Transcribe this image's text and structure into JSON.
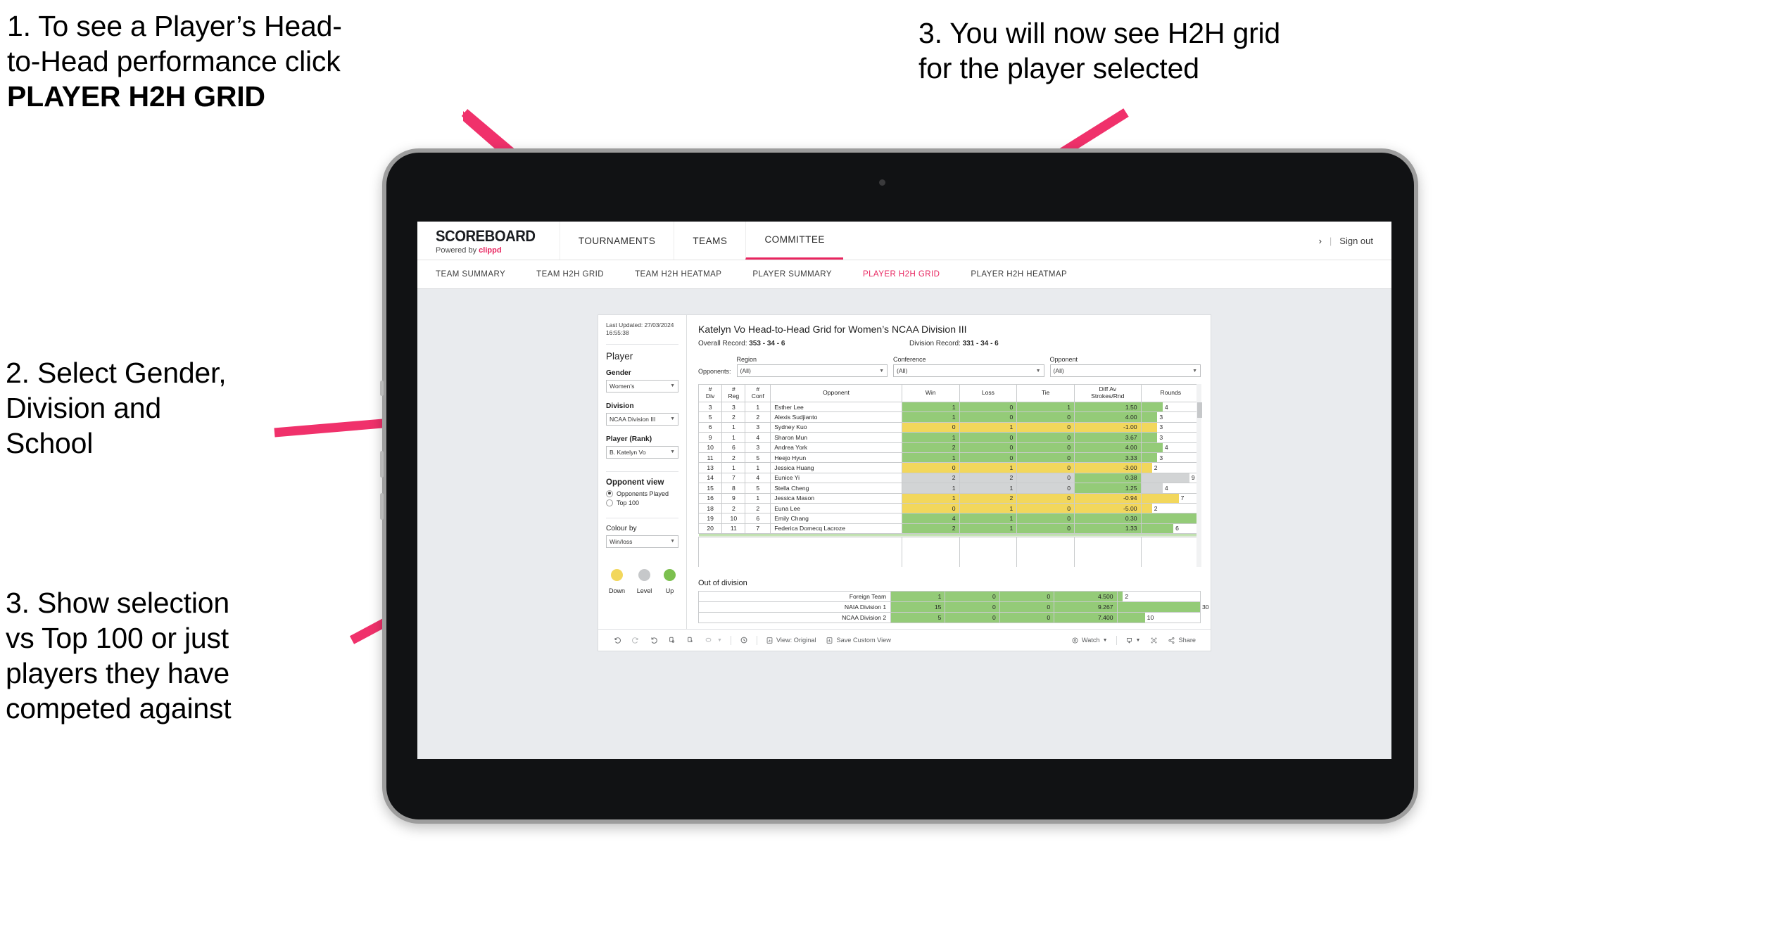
{
  "annotations": {
    "a1_line1": "1. To see a Player’s Head-",
    "a1_line2": "to-Head performance click",
    "a1_bold": "PLAYER H2H GRID",
    "a2": "2. Select Gender,\nDivision and\nSchool",
    "a3": "3. Show selection\nvs Top 100 or just\nplayers they have\ncompeted against",
    "a4": "3. You will now see H2H grid\nfor the player selected"
  },
  "colors": {
    "accent_pink": "#e8255f",
    "arrow_pink": "#f0316b",
    "up_green": "#94cb78",
    "down_yellow": "#f2d75c",
    "level_grey": "#d2d4d5"
  },
  "app": {
    "brand_title": "SCOREBOARD",
    "brand_sub_prefix": "Powered by ",
    "brand_sub_accent": "clippd",
    "topnav": [
      {
        "label": "TOURNAMENTS",
        "active": false
      },
      {
        "label": "TEAMS",
        "active": false
      },
      {
        "label": "COMMITTEE",
        "active": true
      }
    ],
    "signout": {
      "chevron": "›",
      "separator": "|",
      "label": "Sign out"
    },
    "subnav": [
      {
        "label": "TEAM SUMMARY",
        "active": false
      },
      {
        "label": "TEAM H2H GRID",
        "active": false
      },
      {
        "label": "TEAM H2H HEATMAP",
        "active": false
      },
      {
        "label": "PLAYER SUMMARY",
        "active": false
      },
      {
        "label": "PLAYER H2H GRID",
        "active": true
      },
      {
        "label": "PLAYER H2H HEATMAP",
        "active": false
      }
    ]
  },
  "sidebar": {
    "last_updated": "Last Updated: 27/03/2024 16:55:38",
    "player_heading": "Player",
    "filters": [
      {
        "label": "Gender",
        "value": "Women's"
      },
      {
        "label": "Division",
        "value": "NCAA Division III"
      },
      {
        "label": "Player (Rank)",
        "value": "B. Katelyn Vo"
      }
    ],
    "opponent_view": {
      "heading": "Opponent view",
      "options": [
        {
          "label": "Opponents Played",
          "selected": true
        },
        {
          "label": "Top 100",
          "selected": false
        }
      ]
    },
    "colour_by": {
      "label": "Colour by",
      "value": "Win/loss"
    },
    "legend": [
      {
        "label": "Down",
        "color": "#f2d75c"
      },
      {
        "label": "Level",
        "color": "#c6c8ca"
      },
      {
        "label": "Up",
        "color": "#7cc04f"
      }
    ]
  },
  "view": {
    "title": "Katelyn Vo Head-to-Head Grid for Women’s NCAA Division III",
    "overall_record_label": "Overall Record: ",
    "overall_record_value": "353 -  34 - 6",
    "division_record_label": "Division Record: ",
    "division_record_value": "331 -  34 - 6",
    "opponents_label": "Opponents:",
    "opponent_filters": [
      {
        "label": "Region",
        "value": "(All)"
      },
      {
        "label": "Conference",
        "value": "(All)"
      },
      {
        "label": "Opponent",
        "value": "(All)"
      }
    ]
  },
  "chart_data": {
    "type": "table",
    "title": "Katelyn Vo Head-to-Head Grid for Women’s NCAA Division III",
    "columns": [
      "# Div",
      "# Reg",
      "# Conf",
      "Opponent",
      "Win",
      "Loss",
      "Tie",
      "Diff Av Strokes/Rnd",
      "Rounds"
    ],
    "column_header_lines": [
      [
        "#",
        "Div"
      ],
      [
        "#",
        "Reg"
      ],
      [
        "#",
        "Conf"
      ],
      [
        "Opponent",
        ""
      ],
      [
        "Win",
        ""
      ],
      [
        "Loss",
        ""
      ],
      [
        "Tie",
        ""
      ],
      [
        "Diff Av",
        "Strokes/Rnd"
      ],
      [
        "Rounds",
        ""
      ]
    ],
    "rows": [
      {
        "div": "3",
        "reg": "3",
        "conf": "1",
        "opponent": "Esther Lee",
        "win": "1",
        "loss": "0",
        "tie": "1",
        "diff": "1.50",
        "rounds": "4",
        "state": "up"
      },
      {
        "div": "5",
        "reg": "2",
        "conf": "2",
        "opponent": "Alexis Sudjianto",
        "win": "1",
        "loss": "0",
        "tie": "0",
        "diff": "4.00",
        "rounds": "3",
        "state": "up"
      },
      {
        "div": "6",
        "reg": "1",
        "conf": "3",
        "opponent": "Sydney Kuo",
        "win": "0",
        "loss": "1",
        "tie": "0",
        "diff": "-1.00",
        "rounds": "3",
        "state": "down"
      },
      {
        "div": "9",
        "reg": "1",
        "conf": "4",
        "opponent": "Sharon Mun",
        "win": "1",
        "loss": "0",
        "tie": "0",
        "diff": "3.67",
        "rounds": "3",
        "state": "up"
      },
      {
        "div": "10",
        "reg": "6",
        "conf": "3",
        "opponent": "Andrea York",
        "win": "2",
        "loss": "0",
        "tie": "0",
        "diff": "4.00",
        "rounds": "4",
        "state": "up"
      },
      {
        "div": "11",
        "reg": "2",
        "conf": "5",
        "opponent": "Heejo Hyun",
        "win": "1",
        "loss": "0",
        "tie": "0",
        "diff": "3.33",
        "rounds": "3",
        "state": "up"
      },
      {
        "div": "13",
        "reg": "1",
        "conf": "1",
        "opponent": "Jessica Huang",
        "win": "0",
        "loss": "1",
        "tie": "0",
        "diff": "-3.00",
        "rounds": "2",
        "state": "down"
      },
      {
        "div": "14",
        "reg": "7",
        "conf": "4",
        "opponent": "Eunice Yi",
        "win": "2",
        "loss": "2",
        "tie": "0",
        "diff": "0.38",
        "rounds": "9",
        "state": "level"
      },
      {
        "div": "15",
        "reg": "8",
        "conf": "5",
        "opponent": "Stella Cheng",
        "win": "1",
        "loss": "1",
        "tie": "0",
        "diff": "1.25",
        "rounds": "4",
        "state": "level"
      },
      {
        "div": "16",
        "reg": "9",
        "conf": "1",
        "opponent": "Jessica Mason",
        "win": "1",
        "loss": "2",
        "tie": "0",
        "diff": "-0.94",
        "rounds": "7",
        "state": "down"
      },
      {
        "div": "18",
        "reg": "2",
        "conf": "2",
        "opponent": "Euna Lee",
        "win": "0",
        "loss": "1",
        "tie": "0",
        "diff": "-5.00",
        "rounds": "2",
        "state": "down"
      },
      {
        "div": "19",
        "reg": "10",
        "conf": "6",
        "opponent": "Emily Chang",
        "win": "4",
        "loss": "1",
        "tie": "0",
        "diff": "0.30",
        "rounds": "11",
        "state": "up"
      },
      {
        "div": "20",
        "reg": "11",
        "conf": "7",
        "opponent": "Federica Domecq Lacroze",
        "win": "2",
        "loss": "1",
        "tie": "0",
        "diff": "1.33",
        "rounds": "6",
        "state": "up"
      }
    ],
    "max_rounds": 11,
    "out_of_division": {
      "heading": "Out of division",
      "rows": [
        {
          "opponent": "Foreign Team",
          "win": "1",
          "loss": "0",
          "tie": "0",
          "diff": "4.500",
          "rounds": "2",
          "state": "up"
        },
        {
          "opponent": "NAIA Division 1",
          "win": "15",
          "loss": "0",
          "tie": "0",
          "diff": "9.267",
          "rounds": "30",
          "state": "up"
        },
        {
          "opponent": "NCAA Division 2",
          "win": "5",
          "loss": "0",
          "tie": "0",
          "diff": "7.400",
          "rounds": "10",
          "state": "up"
        }
      ],
      "max_rounds": 30
    }
  },
  "toolbar": {
    "view_label": "View: Original",
    "save_label": "Save Custom View",
    "watch_label": "Watch",
    "share_label": "Share"
  }
}
